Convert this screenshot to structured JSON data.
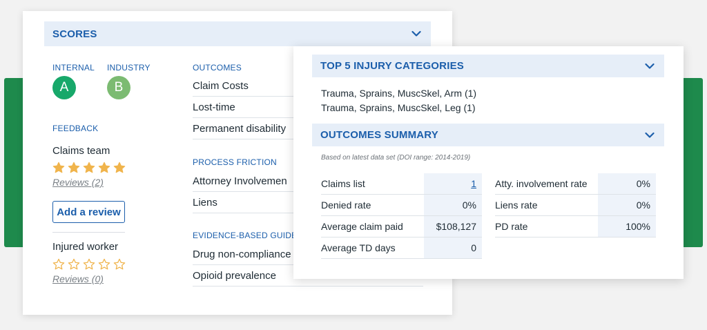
{
  "scores": {
    "title": "SCORES",
    "internal_label": "INTERNAL",
    "internal_grade": "A",
    "industry_label": "INDUSTRY",
    "industry_grade": "B",
    "feedback_label": "FEEDBACK",
    "claims_team": {
      "label": "Claims team",
      "rating": 5,
      "max_rating": 5,
      "reviews": "Reviews (2)",
      "add_review": "Add a review"
    },
    "injured_worker": {
      "label": "Injured worker",
      "rating": 0,
      "max_rating": 5,
      "reviews": "Reviews (0)"
    },
    "outcomes": {
      "label": "OUTCOMES",
      "items": [
        "Claim Costs",
        "Lost-time",
        "Permanent disability"
      ]
    },
    "process_friction": {
      "label": "PROCESS FRICTION",
      "items": [
        "Attorney Involvemen",
        "Liens"
      ]
    },
    "evidence": {
      "label": "EVIDENCE-BASED GUIDELI",
      "items": [
        "Drug non-compliance",
        "Opioid prevalence"
      ]
    }
  },
  "injury": {
    "title": "TOP 5 INJURY CATEGORIES",
    "items": [
      "Trauma, Sprains, MuscSkel, Arm (1)",
      "Trauma, Sprains, MuscSkel, Leg (1)"
    ]
  },
  "summary": {
    "title": "OUTCOMES SUMMARY",
    "note": "Based on latest data set (DOI range: 2014-2019)",
    "left": [
      {
        "label": "Claims list",
        "value": "1"
      },
      {
        "label": "Denied rate",
        "value": "0%"
      },
      {
        "label": "Average claim paid",
        "value": "$108,127"
      },
      {
        "label": "Average TD days",
        "value": "0"
      }
    ],
    "right": [
      {
        "label": "Atty. involvement rate",
        "value": "0%"
      },
      {
        "label": "Liens rate",
        "value": "0%"
      },
      {
        "label": "PD rate",
        "value": "100%"
      }
    ]
  },
  "colors": {
    "accent": "#1b5eab",
    "header_bg": "#e6eef8",
    "grade_a": "#17a86a",
    "grade_b": "#7cbb72",
    "star": "#f0b44c",
    "band": "#1e8a4c"
  },
  "icons": {
    "chevron": "chevron-down-icon",
    "star_filled": "star-filled-icon",
    "star_outline": "star-outline-icon"
  }
}
